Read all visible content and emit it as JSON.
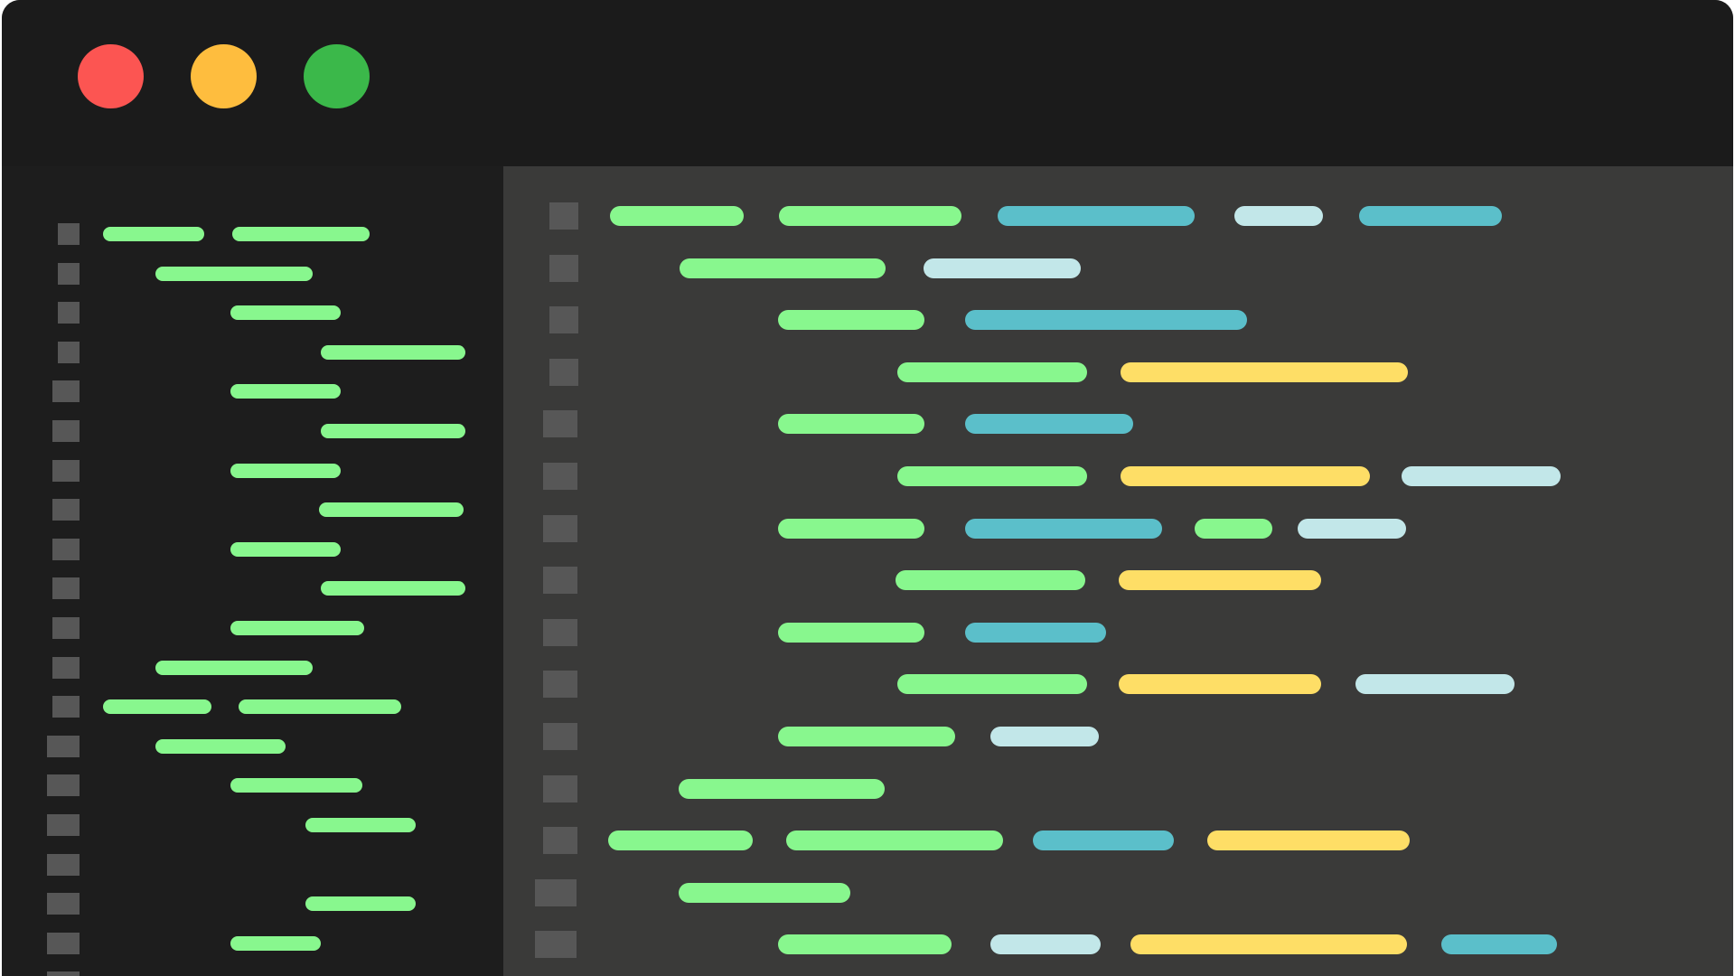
{
  "window": {
    "buttons": [
      {
        "name": "close-button",
        "color": "#fc5552"
      },
      {
        "name": "minimize-button",
        "color": "#febd3e"
      },
      {
        "name": "zoom-button",
        "color": "#3bb84a"
      }
    ]
  },
  "palette": {
    "green": "#88f78e",
    "blue": "#5bbfca",
    "light": "#c2e7e9",
    "yellow": "#fede66",
    "gutter": "#575757"
  }
}
